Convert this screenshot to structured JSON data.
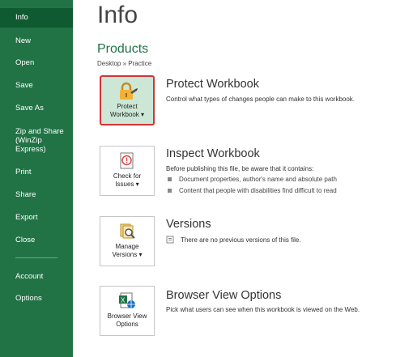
{
  "sidebar": {
    "items": [
      {
        "label": "Info",
        "active": true
      },
      {
        "label": "New"
      },
      {
        "label": "Open"
      },
      {
        "label": "Save"
      },
      {
        "label": "Save As"
      },
      {
        "label": "Zip and Share (WinZip Express)"
      },
      {
        "label": "Print"
      },
      {
        "label": "Share"
      },
      {
        "label": "Export"
      },
      {
        "label": "Close"
      },
      {
        "label": "Account"
      },
      {
        "label": "Options"
      }
    ]
  },
  "page": {
    "title": "Info",
    "section": "Products",
    "breadcrumb": "Desktop » Practice"
  },
  "protect": {
    "button_line1": "Protect",
    "button_line2": "Workbook ▾",
    "title": "Protect Workbook",
    "desc": "Control what types of changes people can make to this workbook."
  },
  "inspect": {
    "button_line1": "Check for",
    "button_line2": "Issues ▾",
    "title": "Inspect Workbook",
    "desc": "Before publishing this file, be aware that it contains:",
    "bullets": [
      "Document properties, author's name and absolute path",
      "Content that people with disabilities find difficult to read"
    ]
  },
  "versions": {
    "button_line1": "Manage",
    "button_line2": "Versions ▾",
    "title": "Versions",
    "desc": "There are no previous versions of this file."
  },
  "browser": {
    "button_line1": "Browser View",
    "button_line2": "Options",
    "title": "Browser View Options",
    "desc": "Pick what users can see when this workbook is viewed on the Web."
  },
  "colors": {
    "sidebar": "#217346",
    "sidebar_active": "#0f5a30",
    "accent": "#217346",
    "selection_border": "#d13438"
  }
}
